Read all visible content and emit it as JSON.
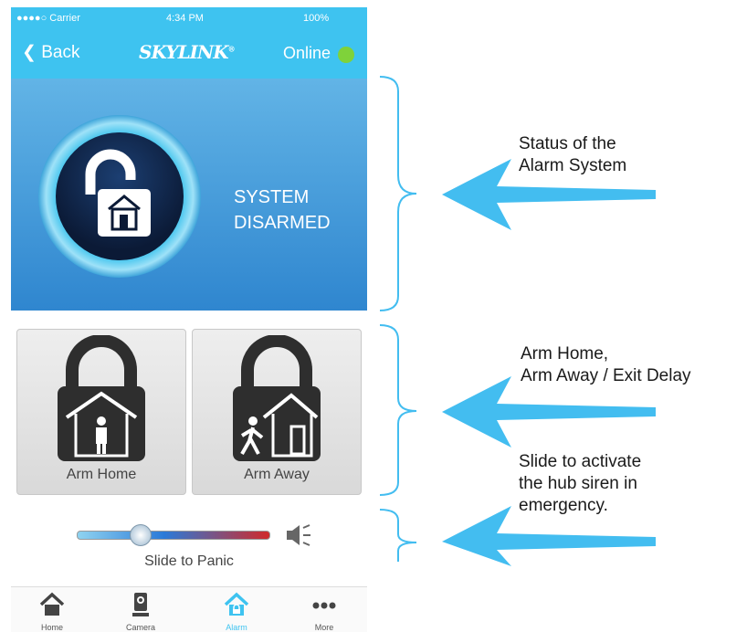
{
  "statusbar": {
    "signal": "●●●●○ Carrier",
    "time": "4:34 PM",
    "battery": "100%"
  },
  "navbar": {
    "back_label": "Back",
    "brand": "SKYLINK",
    "brand_mark": "®",
    "online_label": "Online"
  },
  "status_panel": {
    "line1": "SYSTEM",
    "line2": "DISARMED"
  },
  "arm": {
    "home_label": "Arm Home",
    "away_label": "Arm Away"
  },
  "panic": {
    "label": "Slide to Panic",
    "slider_level": 0.33
  },
  "tabs": [
    {
      "label": "Home",
      "icon": "home-icon"
    },
    {
      "label": "Camera",
      "icon": "camera-icon"
    },
    {
      "label": "Alarm",
      "icon": "alarm-icon",
      "active": true
    },
    {
      "label": "More",
      "icon": "more-icon"
    }
  ],
  "annotations": {
    "status": [
      "Status of the",
      "Alarm System"
    ],
    "arm": [
      "Arm Home,",
      "Arm Away  / Exit Delay"
    ],
    "panic": [
      "Slide to activate",
      "the hub siren in",
      "emergency."
    ]
  },
  "colors": {
    "accent": "#3ec3f0",
    "online": "#7fd23a",
    "arrow": "#43bdf0"
  }
}
